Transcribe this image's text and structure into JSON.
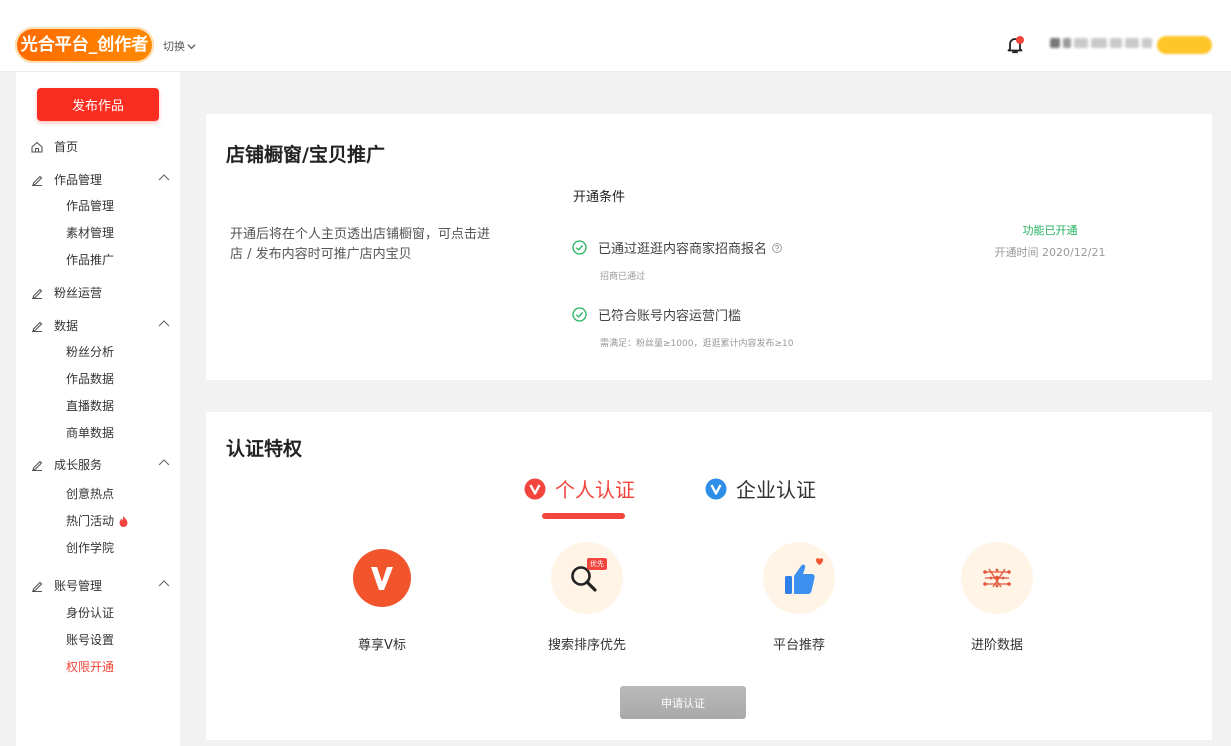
{
  "header": {
    "logo_text": "光合平台_创作者",
    "switch_label": "切换",
    "bell_icon": "bell-icon",
    "accent": "#ff6a00"
  },
  "sidebar": {
    "publish_label": "发布作品",
    "items": [
      {
        "label": "首页",
        "icon": "home-icon"
      },
      {
        "label": "作品管理",
        "icon": "edit-icon",
        "children": [
          "作品管理",
          "素材管理",
          "作品推广"
        ]
      },
      {
        "label": "粉丝运营",
        "icon": "edit-icon"
      },
      {
        "label": "数据",
        "icon": "edit-icon",
        "children": [
          "粉丝分析",
          "作品数据",
          "直播数据",
          "商单数据"
        ]
      },
      {
        "label": "成长服务",
        "icon": "edit-icon",
        "children": [
          "创意热点",
          "热门活动",
          "创作学院"
        ]
      },
      {
        "label": "账号管理",
        "icon": "edit-icon",
        "children": [
          "身份认证",
          "账号设置",
          "权限开通"
        ]
      }
    ],
    "active_item": "权限开通",
    "active_color": "#f2453d"
  },
  "shop_card": {
    "title": "店铺橱窗/宝贝推广",
    "description": "开通后将在个人主页透出店铺橱窗，可点击进店 / 发布内容时可推广店内宝贝",
    "conditions_title": "开通条件",
    "conditions": [
      {
        "text": "已通过逛逛内容商家招商报名",
        "note": "招商已通过"
      },
      {
        "text": "已符合账号内容运营门槛",
        "note": "需满足：粉丝量≥1000，逛逛累计内容发布≥10"
      }
    ],
    "status": "功能已开通",
    "status_time": "开通时间 2020/12/21",
    "status_color": "#21b25e"
  },
  "cert_card": {
    "title": "认证特权",
    "tabs": [
      {
        "label": "个人认证",
        "active": true
      },
      {
        "label": "企业认证",
        "active": false
      }
    ],
    "privileges": [
      {
        "label": "尊享V标",
        "icon": "v-badge-icon"
      },
      {
        "label": "搜索排序优先",
        "icon": "search-priority-icon",
        "tag": "优先"
      },
      {
        "label": "平台推荐",
        "icon": "thumbs-up-icon"
      },
      {
        "label": "进阶数据",
        "icon": "data-network-icon"
      }
    ],
    "apply_label": "申请认证"
  }
}
